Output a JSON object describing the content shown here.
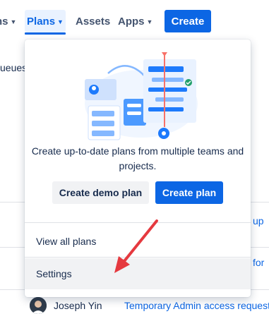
{
  "nav": {
    "fragment": "ns",
    "plans": "Plans",
    "assets": "Assets",
    "apps": "Apps",
    "create": "Create"
  },
  "background": {
    "left_fragment": "ueues",
    "right_link_1": "up",
    "right_link_2": "for",
    "user_name": "Joseph Yin",
    "request_link": "Temporary Admin access request"
  },
  "dropdown": {
    "promo_text": "Create up-to-date plans from multiple teams and projects.",
    "demo_button": "Create demo plan",
    "create_button": "Create plan",
    "menu": {
      "view_all": "View all plans",
      "settings": "Settings"
    }
  },
  "icons": [
    "chevron-down-icon",
    "plans-illustration",
    "annotation-arrow",
    "avatar"
  ],
  "colors": {
    "primary": "#0c66e4",
    "primary_subtle": "#e9f2ff",
    "neutral_button": "#f1f2f4",
    "text": "#172b4d",
    "nav_text": "#44546f",
    "arrow": "#e5393f"
  }
}
